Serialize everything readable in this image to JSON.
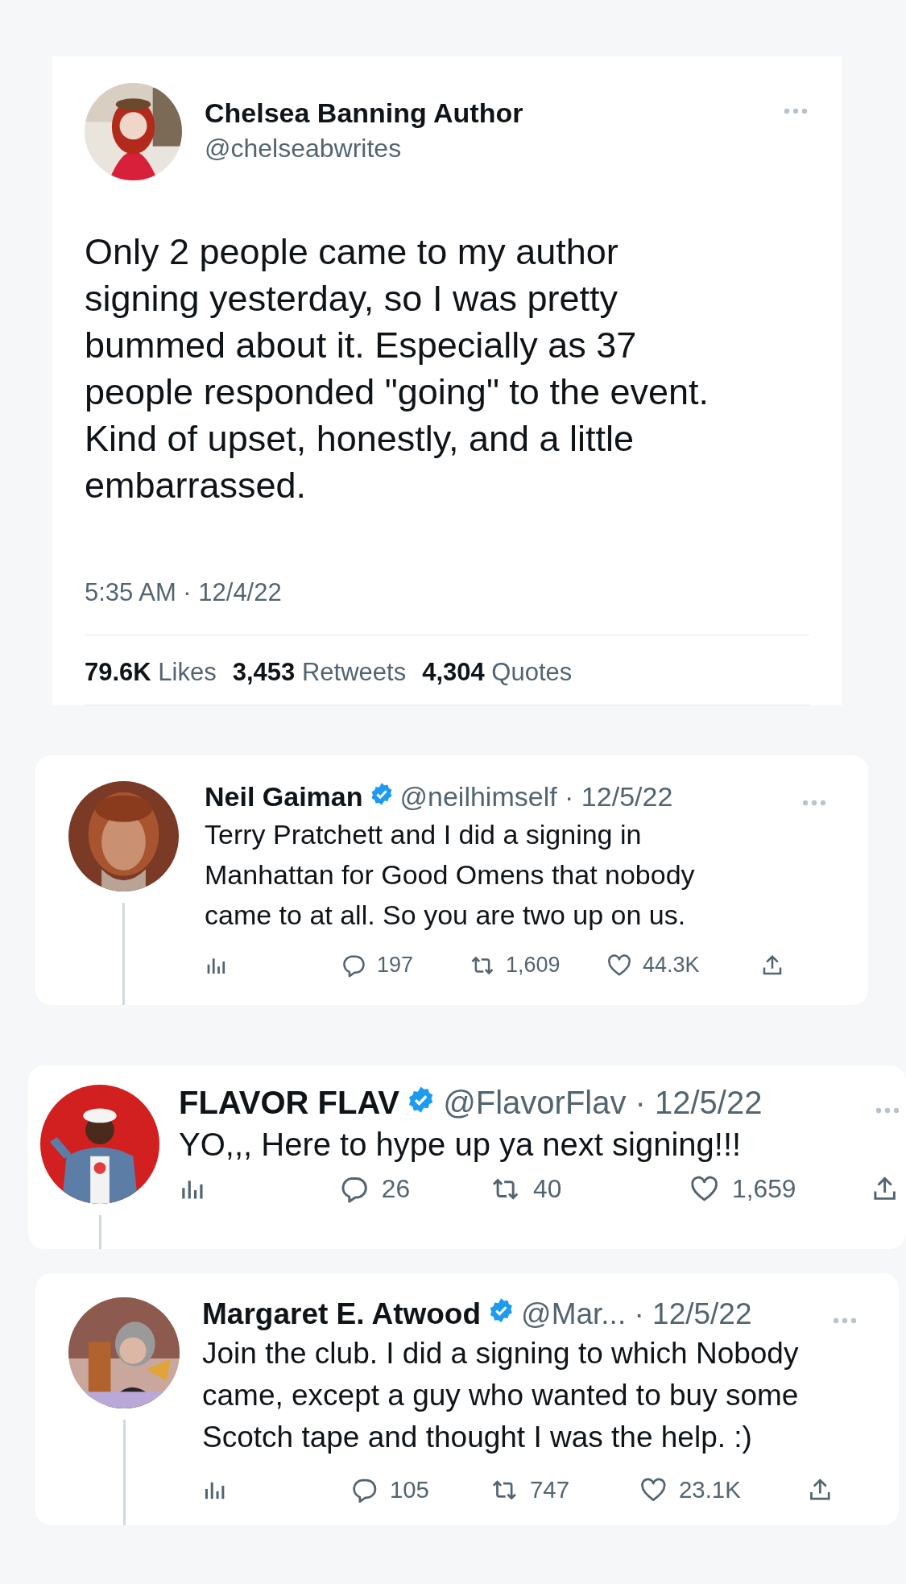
{
  "tweet": {
    "author_name": "Chelsea Banning Author",
    "handle": "@chelseabwrites",
    "text": "Only 2 people came to my author signing yesterday, so I was pretty bummed about it. Especially as 37 people responded \"going\" to the event. Kind of upset, honestly, and a little embarrassed.",
    "timestamp": "5:35 AM · 12/4/22",
    "stats": [
      {
        "count": "79.6K",
        "label": "Likes"
      },
      {
        "count": "3,453",
        "label": "Retweets"
      },
      {
        "count": "4,304",
        "label": "Quotes"
      }
    ]
  },
  "replies": [
    {
      "author_name": "Neil Gaiman",
      "verified": true,
      "meta": "@neilhimself · 12/5/22",
      "text": "Terry Pratchett and I did a signing in Manhattan for Good Omens that nobody came to at all.  So you are two up on us.",
      "replies": "197",
      "retweets": "1,609",
      "likes": "44.3K"
    },
    {
      "author_name": "FLAVOR FLAV",
      "verified": true,
      "meta": "@FlavorFlav · 12/5/22",
      "text": "YO,,, Here to hype up ya next signing!!!",
      "replies": "26",
      "retweets": "40",
      "likes": "1,659"
    },
    {
      "author_name": "Margaret E. Atwood",
      "verified": true,
      "meta": "@Mar... · 12/5/22",
      "text": "Join the club. I did a signing to which Nobody came, except a guy who wanted to buy some Scotch tape and thought I was the help. :)",
      "replies": "105",
      "retweets": "747",
      "likes": "23.1K"
    }
  ]
}
